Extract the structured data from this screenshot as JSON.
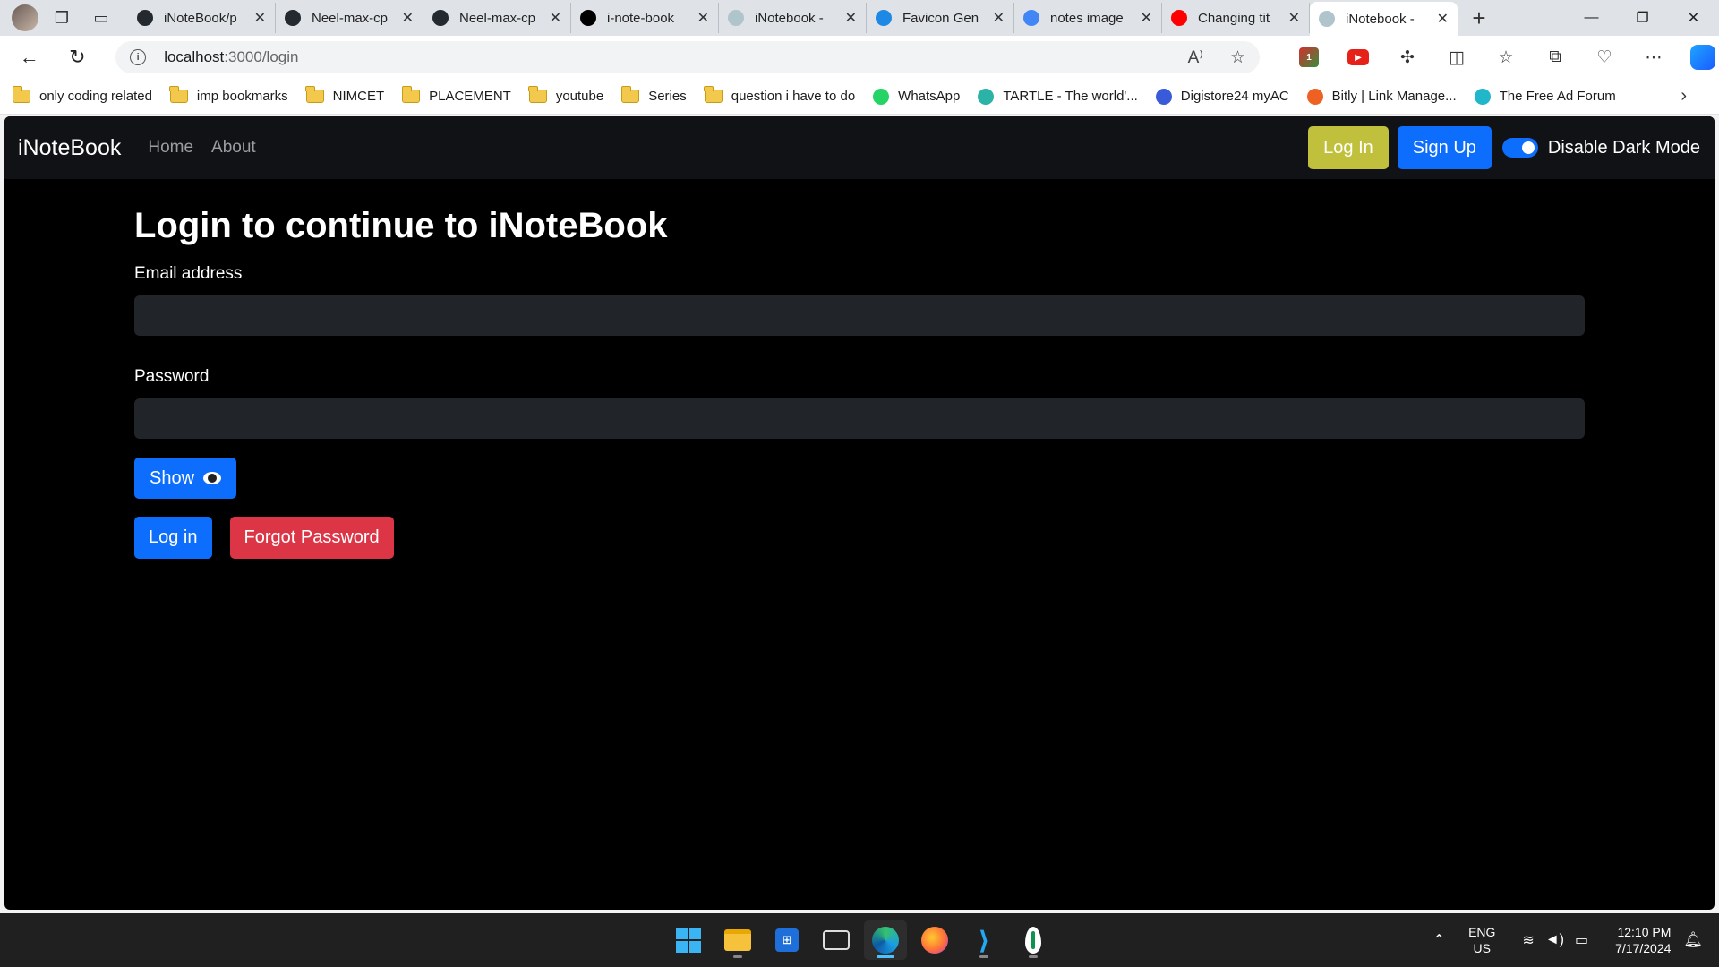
{
  "browser": {
    "tabs": [
      {
        "title": "iNoteBook/p",
        "icon": "github-icon",
        "color": "#24292f"
      },
      {
        "title": "Neel-max-cp",
        "icon": "github-icon",
        "color": "#24292f"
      },
      {
        "title": "Neel-max-cp",
        "icon": "github-icon",
        "color": "#24292f"
      },
      {
        "title": "i-note-book",
        "icon": "vercel-icon",
        "color": "#000000"
      },
      {
        "title": "iNotebook -",
        "icon": "notebook-icon",
        "color": "#b0c4cc"
      },
      {
        "title": "Favicon Gen",
        "icon": "favicon-icon",
        "color": "#1e88e5"
      },
      {
        "title": "notes image",
        "icon": "google-icon",
        "color": "#4285f4"
      },
      {
        "title": "Changing tit",
        "icon": "youtube-icon",
        "color": "#ff0000"
      },
      {
        "title": "iNotebook -",
        "icon": "notebook-icon",
        "color": "#b0c4cc",
        "active": true
      }
    ],
    "new_tab": "+",
    "url_host": "localhost",
    "url_path": ":3000/login",
    "bookmarks": [
      {
        "label": "only coding  related",
        "type": "folder"
      },
      {
        "label": "imp bookmarks",
        "type": "folder"
      },
      {
        "label": "NIMCET",
        "type": "folder"
      },
      {
        "label": "PLACEMENT",
        "type": "folder"
      },
      {
        "label": "youtube",
        "type": "folder"
      },
      {
        "label": "Series",
        "type": "folder"
      },
      {
        "label": "question i have to do",
        "type": "folder"
      },
      {
        "label": "WhatsApp",
        "type": "site",
        "color": "#25d366"
      },
      {
        "label": "TARTLE - The world'...",
        "type": "site",
        "color": "#2bb3a8"
      },
      {
        "label": "Digistore24 myAC",
        "type": "site",
        "color": "#3a5bd9"
      },
      {
        "label": "Bitly | Link Manage...",
        "type": "site",
        "color": "#ee6123"
      },
      {
        "label": "The Free Ad Forum",
        "type": "site",
        "color": "#1fb7c9"
      }
    ]
  },
  "app": {
    "brand": "iNoteBook",
    "nav_home": "Home",
    "nav_about": "About",
    "login_button": "Log In",
    "signup_button": "Sign Up",
    "dark_mode_label": "Disable Dark Mode",
    "heading": "Login to continue to iNoteBook",
    "email_label": "Email address",
    "email_value": "",
    "password_label": "Password",
    "password_value": "",
    "show_button": "Show",
    "submit_button": "Log in",
    "forgot_button": "Forgot Password",
    "colors": {
      "primary": "#0d6efd",
      "warning": "#c0c03c",
      "danger": "#dc3545",
      "navbar": "#111215",
      "page_bg": "#000000",
      "input_bg": "#212429"
    }
  },
  "taskbar": {
    "lang_top": "ENG",
    "lang_bottom": "US",
    "time": "12:10 PM",
    "date": "7/17/2024"
  }
}
